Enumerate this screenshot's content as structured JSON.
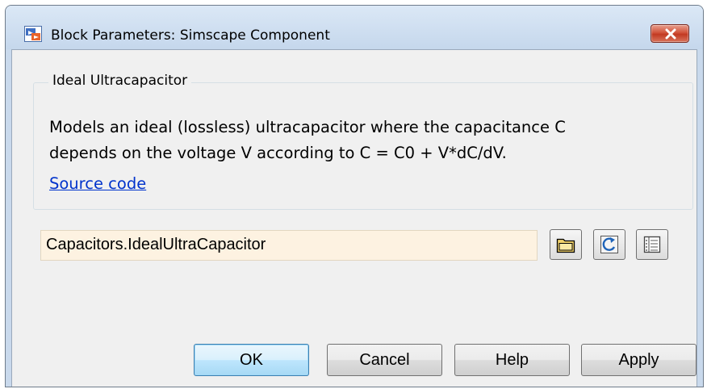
{
  "window": {
    "title": "Block Parameters: Simscape Component"
  },
  "group": {
    "legend": "Ideal Ultracapacitor",
    "description_lines": [
      "Models an ideal (lossless) ultracapacitor where the capacitance C",
      "depends on the voltage V according to C = C0 + V*dC/dV."
    ],
    "source_link": "Source code"
  },
  "component_path": {
    "value": "Capacitors.IdealUltraCapacitor"
  },
  "toolbar_icons": [
    "folder-icon",
    "refresh-icon",
    "list-icon"
  ],
  "buttons": {
    "ok": "OK",
    "cancel": "Cancel",
    "help": "Help",
    "apply": "Apply"
  },
  "colors": {
    "title_bar": "#c5d7ec",
    "dialog_bg": "#f0f0f0",
    "path_field_bg": "#fdf2e1",
    "close_button": "#c23a22",
    "link": "#0033cc",
    "default_button": "#bee6fd"
  }
}
